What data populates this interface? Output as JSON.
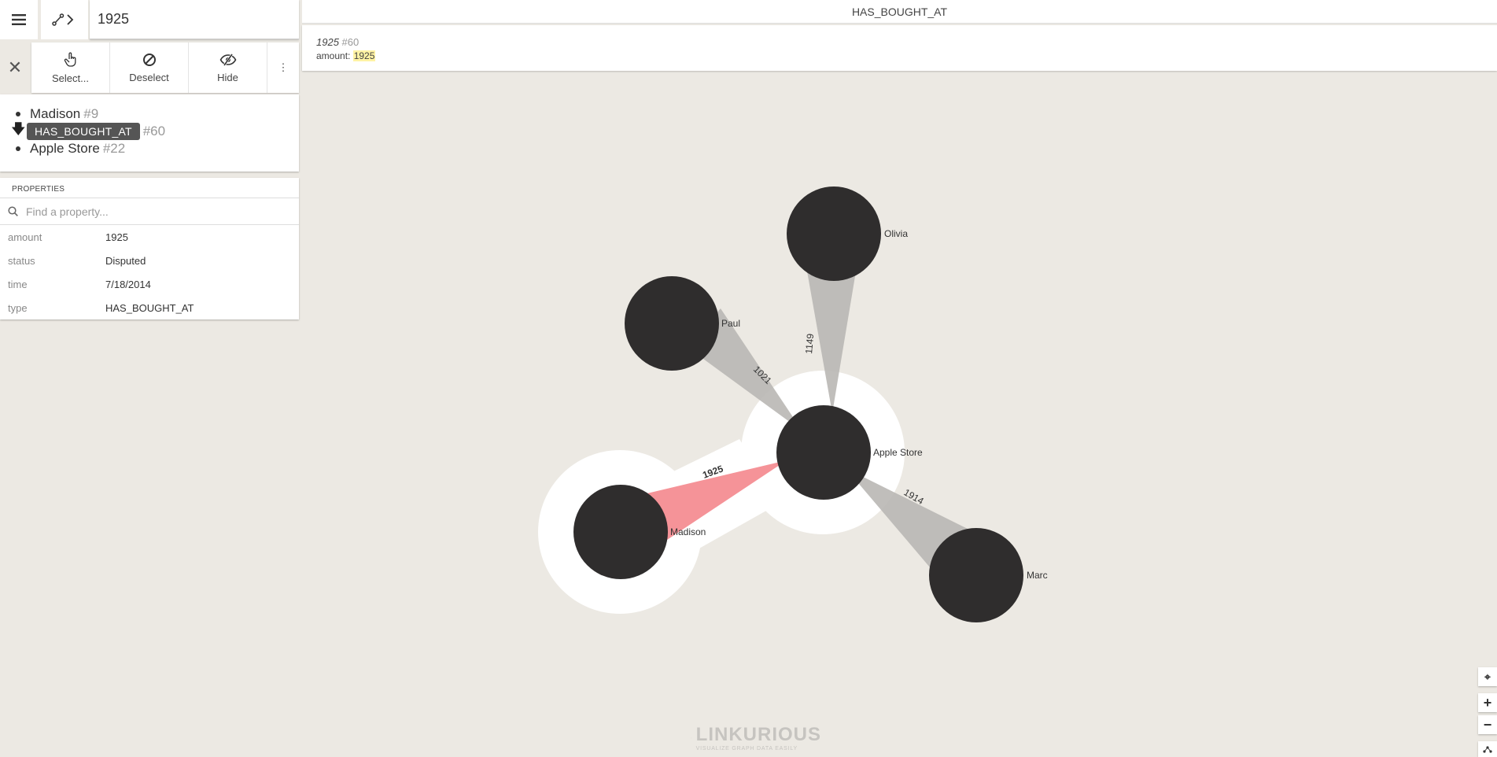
{
  "search": {
    "value": "1925"
  },
  "actions": {
    "select_label": "Select...",
    "deselect_label": "Deselect",
    "hide_label": "Hide",
    "more": "⋮",
    "close": "✕"
  },
  "summary": {
    "source": {
      "name": "Madison",
      "id": "#9"
    },
    "edge": {
      "type": "HAS_BOUGHT_AT",
      "id": "#60"
    },
    "target": {
      "name": "Apple Store",
      "id": "#22"
    }
  },
  "properties": {
    "title": "PROPERTIES",
    "search_placeholder": "Find a property...",
    "rows": [
      {
        "key": "amount",
        "value": "1925"
      },
      {
        "key": "status",
        "value": "Disputed"
      },
      {
        "key": "time",
        "value": "7/18/2014"
      },
      {
        "key": "type",
        "value": "HAS_BOUGHT_AT"
      }
    ]
  },
  "header": {
    "title": "HAS_BOUGHT_AT"
  },
  "tooltip": {
    "label": "1925",
    "id": "#60",
    "amount_key": "amount:",
    "amount_value": "1925"
  },
  "graph": {
    "nodes": {
      "olivia": "Olivia",
      "paul": "Paul",
      "apple_store": "Apple Store",
      "madison": "Madison",
      "marc": "Marc"
    },
    "edges": {
      "olivia_apple": "1149",
      "paul_apple": "1021",
      "madison_apple": "1925",
      "apple_marc": "1914"
    },
    "colors": {
      "node": "#2f2d2d",
      "edge": "#b9b7b4",
      "selected_edge": "#f59398",
      "halo": "#ffffff"
    }
  },
  "zoom": {
    "locate": "⌖",
    "in": "+",
    "out": "−"
  },
  "logo": {
    "name": "LINKURIOUS",
    "tagline": "VISUALIZE GRAPH DATA EASILY"
  }
}
